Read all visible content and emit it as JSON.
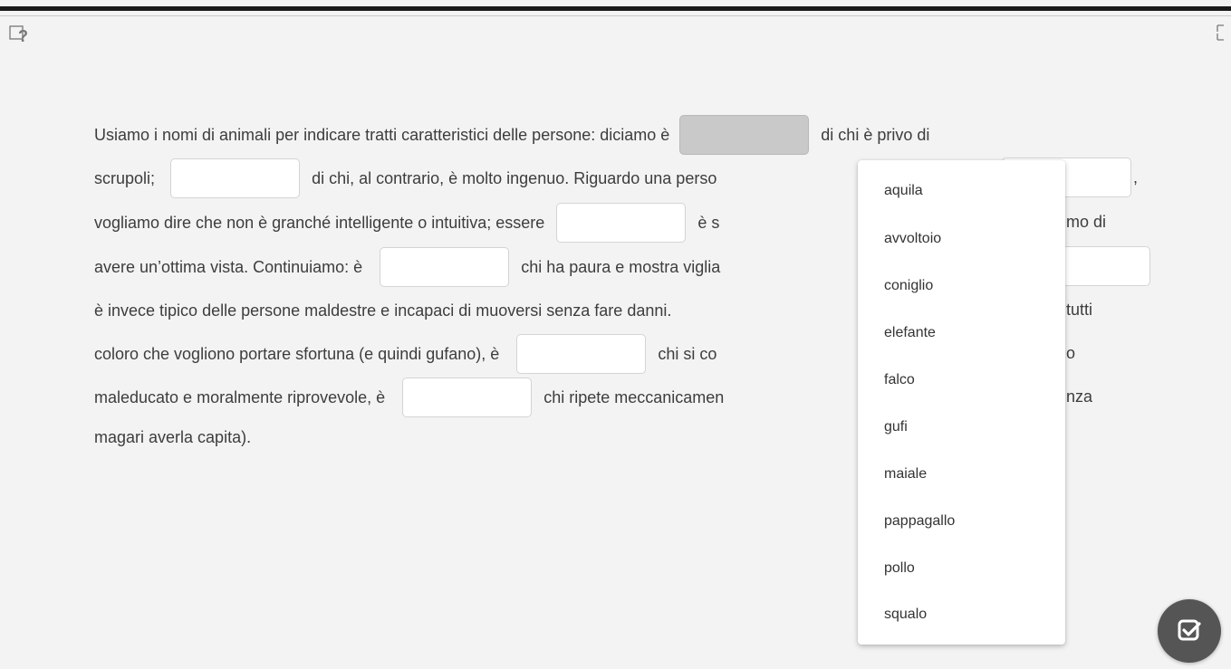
{
  "text": {
    "l1a": "Usiamo i nomi di animali per indicare tratti caratteristici delle persone: diciamo è",
    "l1b": "di chi è privo di",
    "l2a": "scrupoli;",
    "l2b": "di chi, al contrario, è molto ingenuo. Riguardo una perso",
    "l2c": ",",
    "l3a": "vogliamo dire che non è granché intelligente o intuitiva; essere",
    "l3b": "è s",
    "l3c": "mo di",
    "l4a": "avere un’ottima vista. Continuiamo: è",
    "l4b": "chi ha paura e mostra viglia",
    "l5a": "è invece tipico delle persone maldestre e incapaci di muoversi senza fare danni.",
    "l5b": "tutti",
    "l6a": "coloro che vogliono portare sfortuna (e quindi gufano), è",
    "l6b": "chi si co",
    "l6c": "o",
    "l7a": "maleducato e moralmente riprovevole, è",
    "l7b": "chi ripete meccanicamen",
    "l7c": "nza",
    "l8a": "magari averla capita)."
  },
  "dropdown": {
    "options": [
      "aquila",
      "avvoltoio",
      "coniglio",
      "elefante",
      "falco",
      "gufi",
      "maiale",
      "pappagallo",
      "pollo",
      "squalo"
    ]
  },
  "icons": {
    "help": "help-question-icon",
    "corner": "resize-icon",
    "check": "check-icon"
  },
  "colors": {
    "active_blank": "#c9c9c9",
    "check_button": "#555555"
  }
}
